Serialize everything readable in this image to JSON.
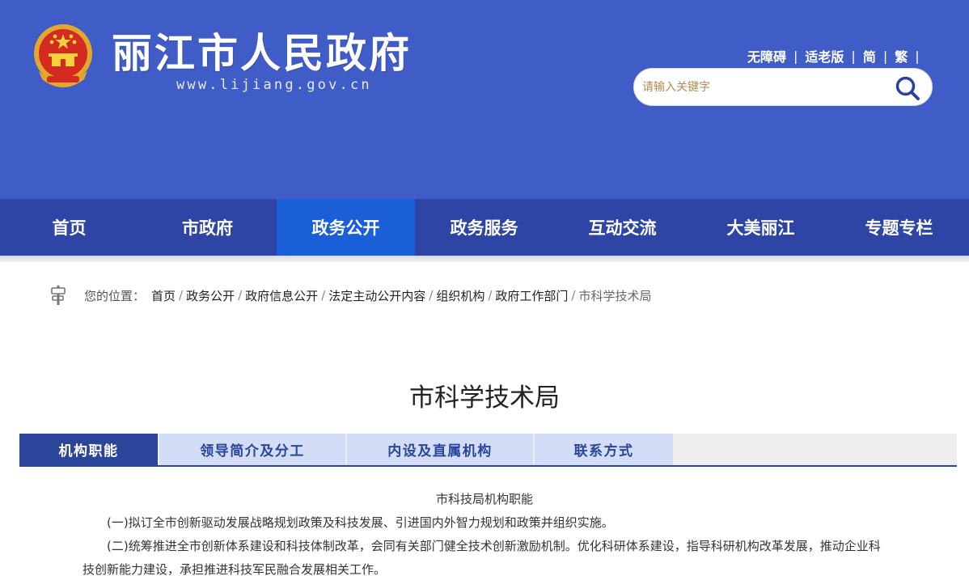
{
  "header": {
    "site_title": "丽江市人民政府",
    "site_url": "www.lijiang.gov.cn",
    "top_links": [
      "无障碍",
      "适老版",
      "简",
      "繁"
    ],
    "search": {
      "placeholder": "请输入关键字"
    },
    "colors": {
      "header_bg": "#3f5cc7",
      "nav_bg": "#2e45a6",
      "nav_active": "#1b5fd8"
    }
  },
  "nav": {
    "items": [
      "首页",
      "市政府",
      "政务公开",
      "政务服务",
      "互动交流",
      "大美丽江",
      "专题专栏"
    ],
    "active": "政务公开"
  },
  "breadcrumb": {
    "prefix": "您的位置：",
    "items": [
      "首页",
      "政务公开",
      "政府信息公开",
      "法定主动公开内容",
      "组织机构",
      "政府工作部门"
    ],
    "current": "市科学技术局"
  },
  "page_title": "市科学技术局",
  "tabs": {
    "items": [
      "机构职能",
      "领导简介及分工",
      "内设及直属机构",
      "联系方式"
    ],
    "active": "机构职能"
  },
  "content": {
    "heading": "市科技局机构职能",
    "paragraphs": [
      "(一)拟订全市创新驱动发展战略规划政策及科技发展、引进国内外智力规划和政策并组织实施。",
      "(二)统筹推进全市创新体系建设和科技体制改革，会同有关部门健全技术创新激励机制。优化科研体系建设，指导科研机构改革发展，推动企业科技创新能力建设，承担推进科技军民融合发展相关工作。"
    ]
  }
}
